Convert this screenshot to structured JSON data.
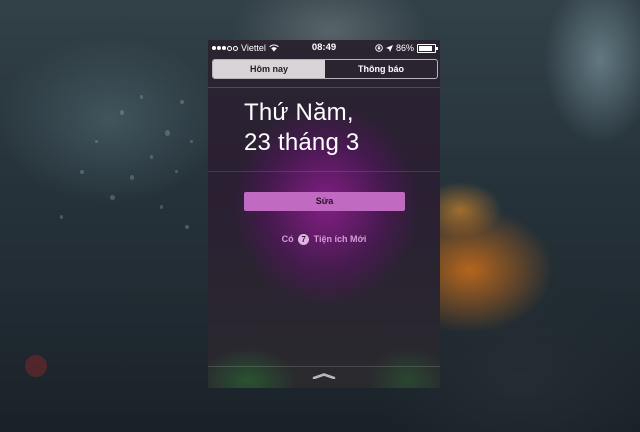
{
  "status": {
    "carrier": "Viettel",
    "time": "08:49",
    "battery": "86%",
    "battery_level": 0.86
  },
  "tabs": [
    {
      "label": "Hôm nay",
      "active": true
    },
    {
      "label": "Thông báo",
      "active": false
    }
  ],
  "date": {
    "weekday": "Thứ Năm,",
    "day_month": "23 tháng 3"
  },
  "edit_label": "Sửa",
  "new_widgets": {
    "prefix": "Có",
    "count": "7",
    "suffix": "Tiện ích Mới"
  },
  "colors": {
    "accent": "#c06ac2",
    "link": "#d89bd8"
  },
  "icons": [
    "signal-dots-icon",
    "wifi-icon",
    "rotation-lock-icon",
    "location-arrow-icon",
    "battery-icon",
    "pull-handle-icon"
  ]
}
